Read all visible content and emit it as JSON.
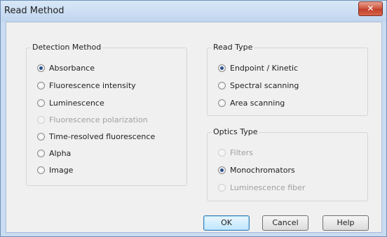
{
  "window": {
    "title": "Read Method",
    "close_glyph": "✕"
  },
  "detection": {
    "legend": "Detection Method",
    "options": [
      {
        "label": "Absorbance",
        "checked": true,
        "disabled": false
      },
      {
        "label": "Fluorescence intensity",
        "checked": false,
        "disabled": false
      },
      {
        "label": "Luminescence",
        "checked": false,
        "disabled": false
      },
      {
        "label": "Fluorescence polarization",
        "checked": false,
        "disabled": true
      },
      {
        "label": "Time-resolved fluorescence",
        "checked": false,
        "disabled": false
      },
      {
        "label": "Alpha",
        "checked": false,
        "disabled": false
      },
      {
        "label": "Image",
        "checked": false,
        "disabled": false
      }
    ]
  },
  "read_type": {
    "legend": "Read Type",
    "options": [
      {
        "label": "Endpoint / Kinetic",
        "checked": true,
        "disabled": false
      },
      {
        "label": "Spectral scanning",
        "checked": false,
        "disabled": false
      },
      {
        "label": "Area scanning",
        "checked": false,
        "disabled": false
      }
    ]
  },
  "optics_type": {
    "legend": "Optics Type",
    "options": [
      {
        "label": "Filters",
        "checked": false,
        "disabled": true
      },
      {
        "label": "Monochromators",
        "checked": true,
        "disabled": false
      },
      {
        "label": "Luminescence fiber",
        "checked": false,
        "disabled": true
      }
    ]
  },
  "buttons": {
    "ok": "OK",
    "cancel": "Cancel",
    "help": "Help"
  },
  "colors": {
    "title_bar": "#c9dcf1",
    "close_button": "#c94a35",
    "default_button": "#bee6fd",
    "radio_dot": "#2a4f8e"
  }
}
